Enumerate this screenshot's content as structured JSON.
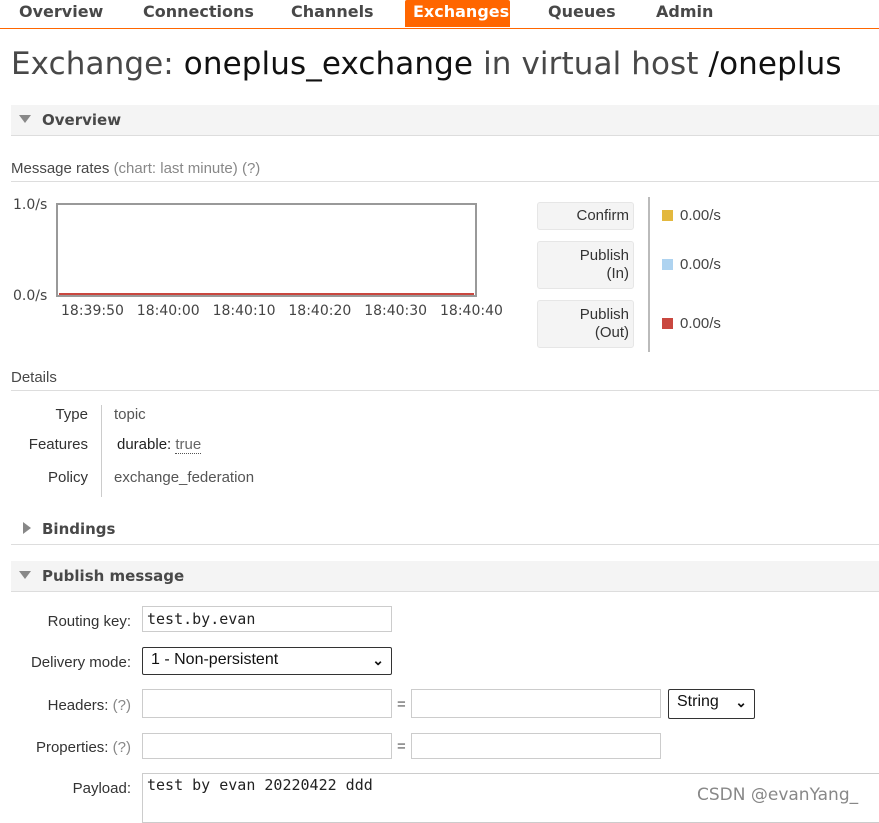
{
  "nav": {
    "items": [
      "Overview",
      "Connections",
      "Channels",
      "Exchanges",
      "Queues",
      "Admin"
    ],
    "active": "Exchanges"
  },
  "title": {
    "prefix": "Exchange:",
    "exchange_name": "oneplus_exchange",
    "middle": "in virtual host",
    "vhost": "/oneplus"
  },
  "overview_section": {
    "label": "Overview",
    "message_rates_label": "Message rates",
    "chart_note": "(chart: last minute)",
    "help": "(?)"
  },
  "chart_data": {
    "type": "line",
    "x": [
      "18:39:50",
      "18:40:00",
      "18:40:10",
      "18:40:20",
      "18:40:30",
      "18:40:40"
    ],
    "yticks": [
      "1.0/s",
      "0.0/s"
    ],
    "ylim": [
      0,
      1
    ],
    "series": [
      {
        "name": "Confirm",
        "color": "#e3b83e",
        "values": [
          0,
          0,
          0,
          0,
          0,
          0
        ]
      },
      {
        "name": "Publish (In)",
        "color": "#aed3f0",
        "values": [
          0,
          0,
          0,
          0,
          0,
          0
        ]
      },
      {
        "name": "Publish (Out)",
        "color": "#c9473f",
        "values": [
          0,
          0,
          0,
          0,
          0,
          0
        ]
      }
    ]
  },
  "legend": [
    {
      "label_lines": [
        "Confirm"
      ],
      "value": "0.00/s",
      "color": "#e3b83e"
    },
    {
      "label_lines": [
        "Publish",
        "(In)"
      ],
      "value": "0.00/s",
      "color": "#aed3f0"
    },
    {
      "label_lines": [
        "Publish",
        "(Out)"
      ],
      "value": "0.00/s",
      "color": "#c9473f"
    }
  ],
  "details": {
    "heading": "Details",
    "type_label": "Type",
    "type_value": "topic",
    "features_label": "Features",
    "features_key": "durable:",
    "features_value": "true",
    "policy_label": "Policy",
    "policy_value": "exchange_federation"
  },
  "bindings_section": {
    "label": "Bindings"
  },
  "publish_section": {
    "label": "Publish message",
    "routing_key_label": "Routing key:",
    "routing_key_value": "test.by.evan",
    "delivery_mode_label": "Delivery mode:",
    "delivery_mode_value": "1 - Non-persistent",
    "headers_label": "Headers:",
    "headers_help": "(?)",
    "headers_type_value": "String",
    "properties_label": "Properties:",
    "properties_help": "(?)",
    "equals": "=",
    "payload_label": "Payload:",
    "payload_value": "test by evan 20220422 ddd"
  },
  "watermark": "CSDN @evanYang_",
  "icons": {
    "dropdown": "chevron-down-icon",
    "section_open": "triangle-down-icon",
    "section_closed": "triangle-right-icon"
  }
}
